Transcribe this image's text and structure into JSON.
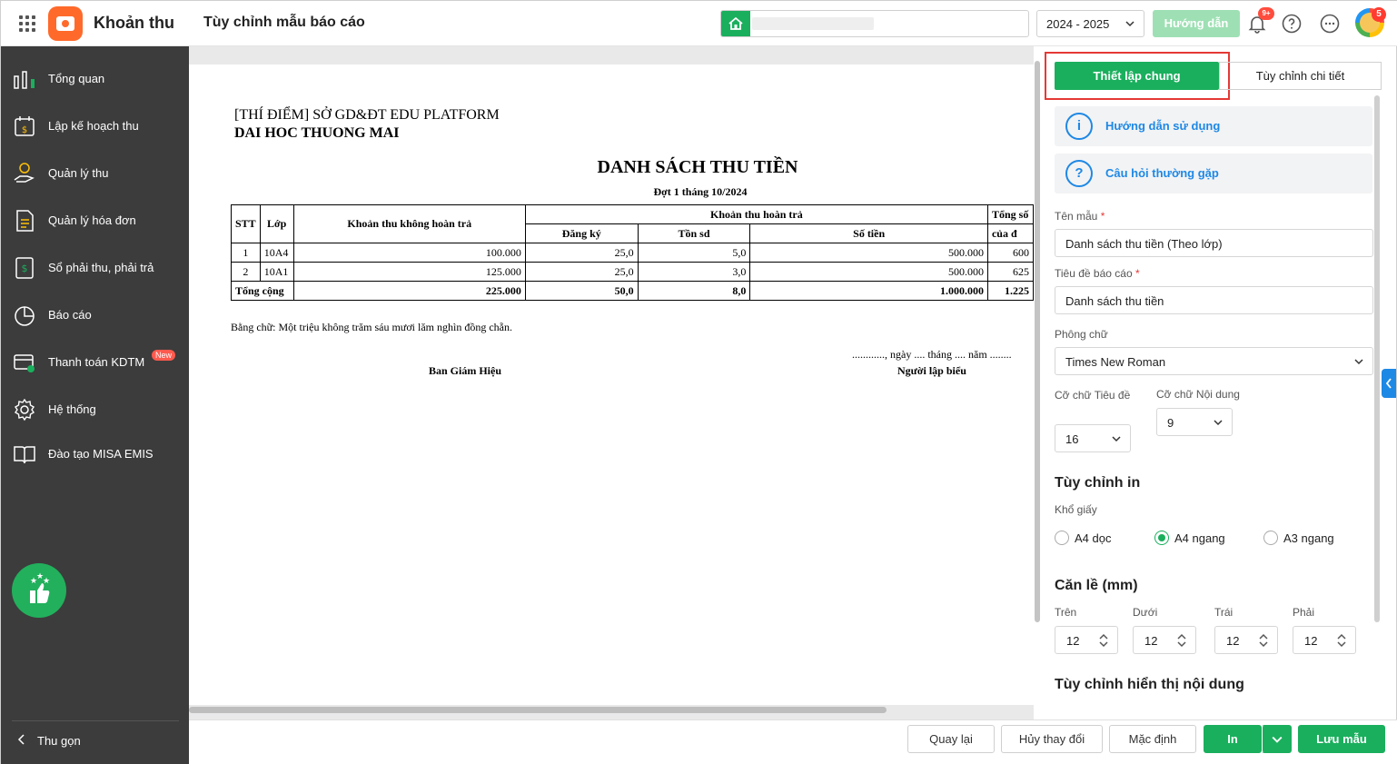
{
  "header": {
    "app_title": "Khoản thu",
    "page_title": "Tùy chỉnh mẫu báo cáo",
    "school_year": "2024 - 2025",
    "guide_label": "Hướng dẫn",
    "notification_count": "9+",
    "avatar_badge": "5"
  },
  "sidebar": {
    "items": [
      {
        "label": "Tổng quan",
        "icon": "chart-bars-icon"
      },
      {
        "label": "Lập kế hoạch thu",
        "icon": "calendar-money-icon"
      },
      {
        "label": "Quản lý thu",
        "icon": "hand-coin-icon"
      },
      {
        "label": "Quản lý hóa đơn",
        "icon": "invoice-icon"
      },
      {
        "label": "Sổ phải thu, phải trả",
        "icon": "ledger-icon"
      },
      {
        "label": "Báo cáo",
        "icon": "pie-chart-icon"
      },
      {
        "label": "Thanh toán KDTM",
        "icon": "card-payment-icon",
        "badge": "New"
      },
      {
        "label": "Hệ thống",
        "icon": "gear-icon"
      },
      {
        "label": "Đào tạo MISA EMIS",
        "icon": "book-icon"
      }
    ],
    "collapse_label": "Thu gọn"
  },
  "report": {
    "org_line1": "[THÍ ĐIỂM] SỞ GD&ĐT EDU PLATFORM",
    "org_line2": "DAI HOC THUONG MAI",
    "title": "DANH SÁCH THU TIỀN",
    "subtitle": "Đợt 1 tháng 10/2024",
    "headers": {
      "stt": "STT",
      "lop": "Lớp",
      "non_refund": "Khoản thu không hoàn trả",
      "refund": "Khoản thu hoàn trả",
      "registered": "Đăng ký",
      "remaining": "Tồn sd",
      "amount": "Số tiền",
      "total_col": "Tổng số",
      "total_col2": "của đ"
    },
    "rows": [
      {
        "stt": "1",
        "lop": "10A4",
        "non_refund": "100.000",
        "registered": "25,0",
        "remaining": "5,0",
        "amount": "500.000",
        "total": "600"
      },
      {
        "stt": "2",
        "lop": "10A1",
        "non_refund": "125.000",
        "registered": "25,0",
        "remaining": "3,0",
        "amount": "500.000",
        "total": "625"
      }
    ],
    "total_row": {
      "label": "Tổng cộng",
      "non_refund": "225.000",
      "registered": "50,0",
      "remaining": "8,0",
      "amount": "1.000.000",
      "total": "1.225"
    },
    "amount_in_words": "Bằng chữ: Một triệu không trăm sáu mươi lăm nghìn đồng chẵn.",
    "date_line": "............, ngày .... tháng .... năm ........",
    "sign_left": "Ban Giám Hiệu",
    "sign_right": "Người lập biểu"
  },
  "panel": {
    "tab_general": "Thiết lập chung",
    "tab_detail": "Tùy chỉnh chi tiết",
    "help_usage": "Hướng dẫn sử dụng",
    "help_faq": "Câu hỏi thường gặp",
    "template_name_label": "Tên mẫu",
    "template_name_value": "Danh sách thu tiền (Theo lớp)",
    "report_title_label": "Tiêu đề báo cáo",
    "report_title_value": "Danh sách thu tiền",
    "font_label": "Phông chữ",
    "font_value": "Times New Roman",
    "title_size_label": "Cỡ chữ Tiêu đề",
    "title_size_value": "16",
    "content_size_label": "Cỡ chữ Nội dung",
    "content_size_value": "9",
    "print_section": "Tùy chỉnh in",
    "paper_label": "Khổ giấy",
    "paper_options": [
      "A4 dọc",
      "A4 ngang",
      "A3 ngang"
    ],
    "paper_selected": "A4 ngang",
    "margin_section": "Căn lề (mm)",
    "margins": [
      {
        "label": "Trên",
        "value": "12"
      },
      {
        "label": "Dưới",
        "value": "12"
      },
      {
        "label": "Trái",
        "value": "12"
      },
      {
        "label": "Phải",
        "value": "12"
      }
    ],
    "display_section": "Tùy chỉnh hiển thị nội dung"
  },
  "footer": {
    "back": "Quay lại",
    "discard": "Hủy thay đổi",
    "default": "Mặc định",
    "print": "In",
    "save": "Lưu mẫu"
  },
  "colors": {
    "accent_green": "#1aaf5d",
    "sidebar_bg": "#3c3c3c",
    "link_blue": "#1e88e5",
    "highlight_red": "#e53935"
  }
}
